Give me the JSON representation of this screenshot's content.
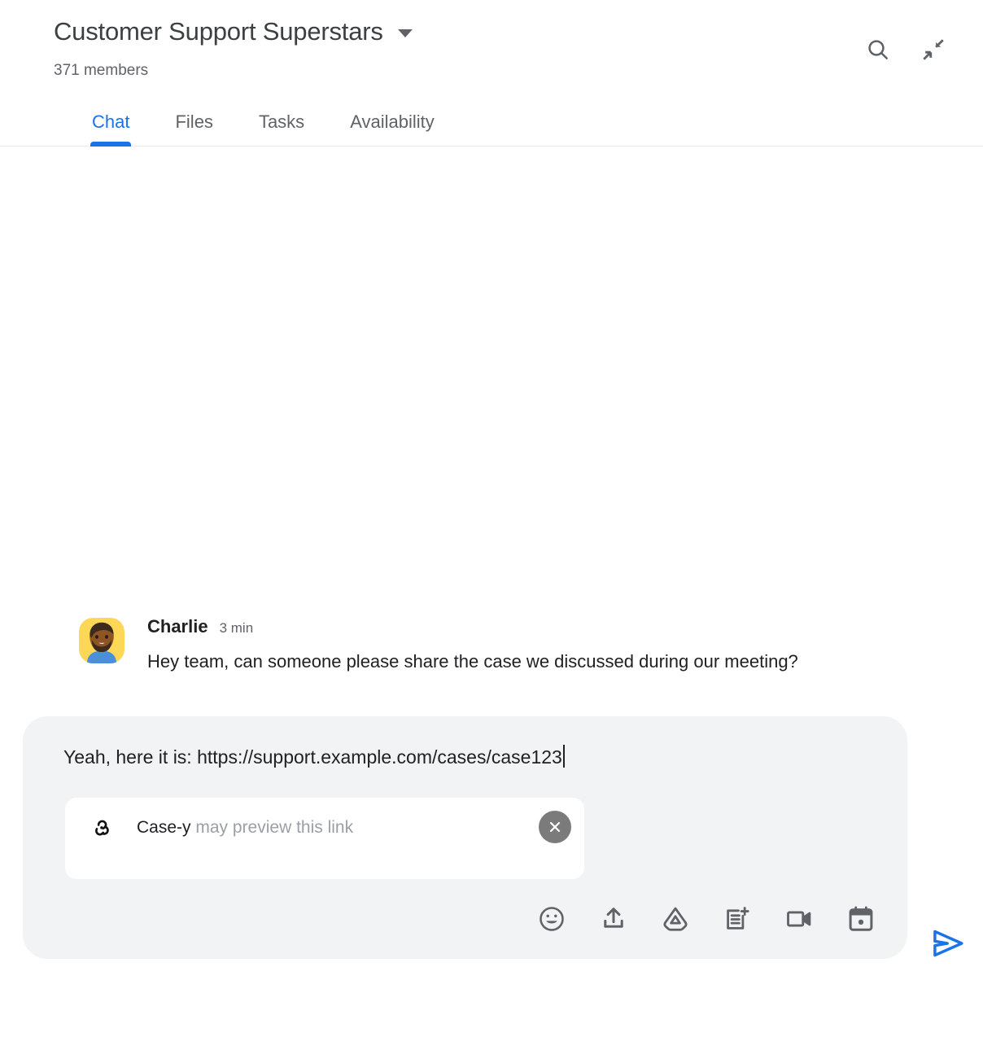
{
  "header": {
    "room_title": "Customer Support Superstars",
    "member_count": "371 members",
    "dropdown_icon": "chevron-down-icon",
    "actions": [
      {
        "name": "search-icon",
        "label": "Search"
      },
      {
        "name": "collapse-icon",
        "label": "Collapse"
      }
    ]
  },
  "tabs": [
    {
      "label": "Chat",
      "active": true
    },
    {
      "label": "Files",
      "active": false
    },
    {
      "label": "Tasks",
      "active": false
    },
    {
      "label": "Availability",
      "active": false
    }
  ],
  "messages": [
    {
      "author": "Charlie",
      "time": "3 min",
      "text": "Hey team, can someone please share the case we discussed during our meeting?",
      "avatar": "bearded-man-avatar"
    }
  ],
  "compose": {
    "text": "Yeah, here it is: https://support.example.com/cases/case123",
    "preview": {
      "icon": "webhook-icon",
      "app_name": "Case-y",
      "hint": " may preview this link",
      "close_label": "Dismiss preview"
    },
    "toolbar": [
      {
        "name": "emoji-icon",
        "label": "Insert emoji"
      },
      {
        "name": "upload-icon",
        "label": "Upload file"
      },
      {
        "name": "google-drive-icon",
        "label": "Add from Drive"
      },
      {
        "name": "new-document-icon",
        "label": "Create new document"
      },
      {
        "name": "video-camera-icon",
        "label": "Add video meeting"
      },
      {
        "name": "calendar-icon",
        "label": "Create event"
      }
    ],
    "send_label": "Send"
  },
  "colors": {
    "accent": "#1a73e8",
    "text_primary": "#202124",
    "text_secondary": "#5f6368",
    "text_muted": "#9aa0a6",
    "compose_bg": "#f1f3f4",
    "card_bg": "#ffffff",
    "page_bg": "#ffffff",
    "divider": "#e8eaed",
    "close_circle": "#7b7b7b"
  }
}
